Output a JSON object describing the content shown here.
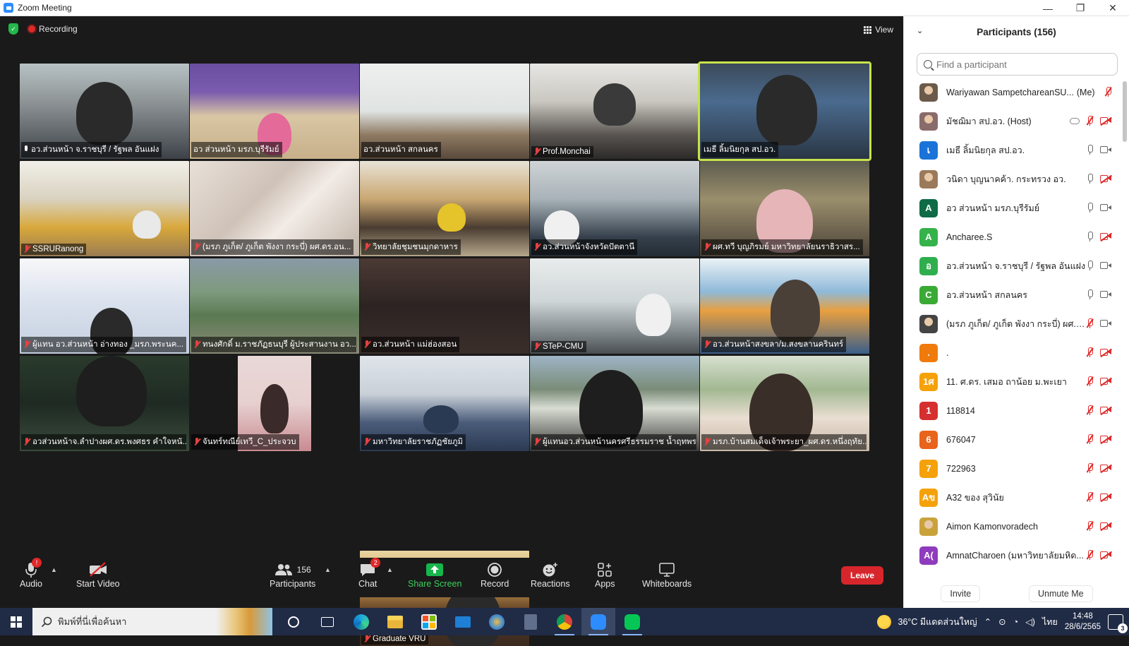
{
  "window": {
    "title": "Zoom Meeting",
    "minimize": "—",
    "maximize": "❐",
    "close": "✕"
  },
  "video": {
    "recording_label": "Recording",
    "view_label": "View",
    "tiles": [
      {
        "name": "อว.ส่วนหน้า จ.ราชบุรี / รัฐพล อันแฝง",
        "audio": "on"
      },
      {
        "name": "อว ส่วนหน้า มรภ.บุรีรัมย์",
        "audio": "none"
      },
      {
        "name": "อว.ส่วนหน้า สกลนคร",
        "audio": "none"
      },
      {
        "name": "Prof.Monchai",
        "audio": "muted"
      },
      {
        "name": "เมธี ลิ้มนิยกุล สป.อว.",
        "audio": "none"
      },
      {
        "name": "SSRURanong",
        "audio": "muted"
      },
      {
        "name": "(มรภ ภูเก็ต/ ภูเก็ต พังงา กระบี่) ผศ.ดร.อน...",
        "audio": "muted"
      },
      {
        "name": "วิทยาลัยชุมชนมุกดาหาร",
        "audio": "muted"
      },
      {
        "name": "อว.ส่วนหน้าจังหวัดปัตตานี",
        "audio": "muted"
      },
      {
        "name": "ผศ.ทวี บุญภิรมย์ มหาวิทยาลัยนราธิวาสร...",
        "audio": "muted"
      },
      {
        "name": "ผู้แทน อว.ส่วนหน้า อ่างทอง _มรภ.พระนค...",
        "audio": "muted"
      },
      {
        "name": "ทนงศักดิ์ ม.ราชภัฏธนบุรี ผู้ประสานงาน อว...",
        "audio": "muted"
      },
      {
        "name": "อว.ส่วนหน้า แม่ฮ่องสอน",
        "audio": "muted"
      },
      {
        "name": "STeP-CMU",
        "audio": "muted"
      },
      {
        "name": "อว.ส่วนหน้าสงขลา/ม.สงขลานครินทร์",
        "audio": "muted"
      },
      {
        "name": "อวส่วนหน้าจ.ลำปางผศ.ดร.พงศธร คำใจหนั...",
        "audio": "muted"
      },
      {
        "name": "จันทร์ทณีย์เทวี_C_ประจวบ",
        "audio": "muted"
      },
      {
        "name": "มหาวิทยาลัยราชภัฏชัยภูมิ",
        "audio": "muted"
      },
      {
        "name": "ผู้แทนอว.ส่วนหน้านครศรีธรรมราช น้ำฤทพร",
        "audio": "muted"
      },
      {
        "name": "มรภ.บ้านสมเด็จเจ้าพระยา_ผศ.ดร.หนึ่งฤทัย...",
        "audio": "muted"
      },
      {
        "name": "Graduate VRU",
        "audio": "muted"
      }
    ]
  },
  "toolbar": {
    "audio": "Audio",
    "audio_badge": "!",
    "start_video": "Start Video",
    "participants": "Participants",
    "participants_count": "156",
    "chat": "Chat",
    "chat_badge": "2",
    "share_screen": "Share Screen",
    "record": "Record",
    "reactions": "Reactions",
    "apps": "Apps",
    "whiteboards": "Whiteboards",
    "leave": "Leave"
  },
  "participants_panel": {
    "title": "Participants (156)",
    "search_placeholder": "Find a participant",
    "invite": "Invite",
    "unmute_me": "Unmute Me",
    "list": [
      {
        "name": "Wariyawan SampetchareanSU...",
        "tag": "(Me)",
        "avatar": "",
        "avatar_color": "#6b5a4a",
        "photo": true,
        "mic": "muted",
        "cam": "none"
      },
      {
        "name": "มัชฌิมา สป.อว. (Host)",
        "tag": "",
        "avatar": "",
        "avatar_color": "#8a6b6b",
        "photo": true,
        "mic": "muted",
        "cam": "off",
        "cloud": true
      },
      {
        "name": "เมธี ลิ้มนิยกุล สป.อว.",
        "tag": "",
        "avatar": "เ",
        "avatar_color": "#1a73d9",
        "mic": "on",
        "cam": "on"
      },
      {
        "name": "วนิดา บุญนาคค้า. กระทรวง อว.",
        "tag": "",
        "avatar": "",
        "avatar_color": "#9a7a5a",
        "photo": true,
        "mic": "on",
        "cam": "off"
      },
      {
        "name": "อว ส่วนหน้า มรภ.บุรีรัมย์",
        "tag": "",
        "avatar": "A",
        "avatar_color": "#0e6b46",
        "mic": "on",
        "cam": "on"
      },
      {
        "name": "Ancharee.S",
        "tag": "",
        "avatar": "A",
        "avatar_color": "#35b24a",
        "mic": "on",
        "cam": "off"
      },
      {
        "name": "อว.ส่วนหน้า จ.ราชบุรี / รัฐพล อันแฝง",
        "tag": "",
        "avatar": "อ",
        "avatar_color": "#2fae4e",
        "mic": "on",
        "cam": "on"
      },
      {
        "name": "อว.ส่วนหน้า สกลนคร",
        "tag": "",
        "avatar": "C",
        "avatar_color": "#3aaa35",
        "mic": "on",
        "cam": "on"
      },
      {
        "name": "(มรภ ภูเก็ต/ ภูเก็ต พังงา กระบี่) ผศ.ด...",
        "tag": "",
        "avatar": "",
        "avatar_color": "#444",
        "photo": true,
        "mic": "muted",
        "cam": "on"
      },
      {
        "name": ".",
        "tag": "",
        "avatar": ".",
        "avatar_color": "#f07a0c",
        "mic": "muted",
        "cam": "off"
      },
      {
        "name": "11. ศ.ดร. เสมอ ถาน้อย ม.พะเยา",
        "tag": "",
        "avatar": "1ศ",
        "avatar_color": "#f5a10a",
        "mic": "muted",
        "cam": "off"
      },
      {
        "name": "118814",
        "tag": "",
        "avatar": "1",
        "avatar_color": "#d62f2f",
        "mic": "muted",
        "cam": "off"
      },
      {
        "name": "676047",
        "tag": "",
        "avatar": "6",
        "avatar_color": "#e8641b",
        "mic": "muted",
        "cam": "off"
      },
      {
        "name": "722963",
        "tag": "",
        "avatar": "7",
        "avatar_color": "#f5a10a",
        "mic": "muted",
        "cam": "off"
      },
      {
        "name": "A32 ของ สุวินัย",
        "tag": "",
        "avatar": "Aข",
        "avatar_color": "#f5a10a",
        "mic": "muted",
        "cam": "off"
      },
      {
        "name": "Aimon Kamonvoradech",
        "tag": "",
        "avatar": "",
        "avatar_color": "#c9a23a",
        "photo": true,
        "mic": "muted",
        "cam": "off"
      },
      {
        "name": "AmnatCharoen (มหาวิทยาลัยมหิด...",
        "tag": "",
        "avatar": "A(",
        "avatar_color": "#8e3bbd",
        "mic": "muted",
        "cam": "off"
      }
    ]
  },
  "taskbar": {
    "search_text": "พิมพ์ที่นี่เพื่อค้นหา",
    "weather": "36°C  มีแดดส่วนใหญ่",
    "lang": "ไทย",
    "time": "14:48",
    "date": "28/6/2565",
    "notifications": "3"
  }
}
